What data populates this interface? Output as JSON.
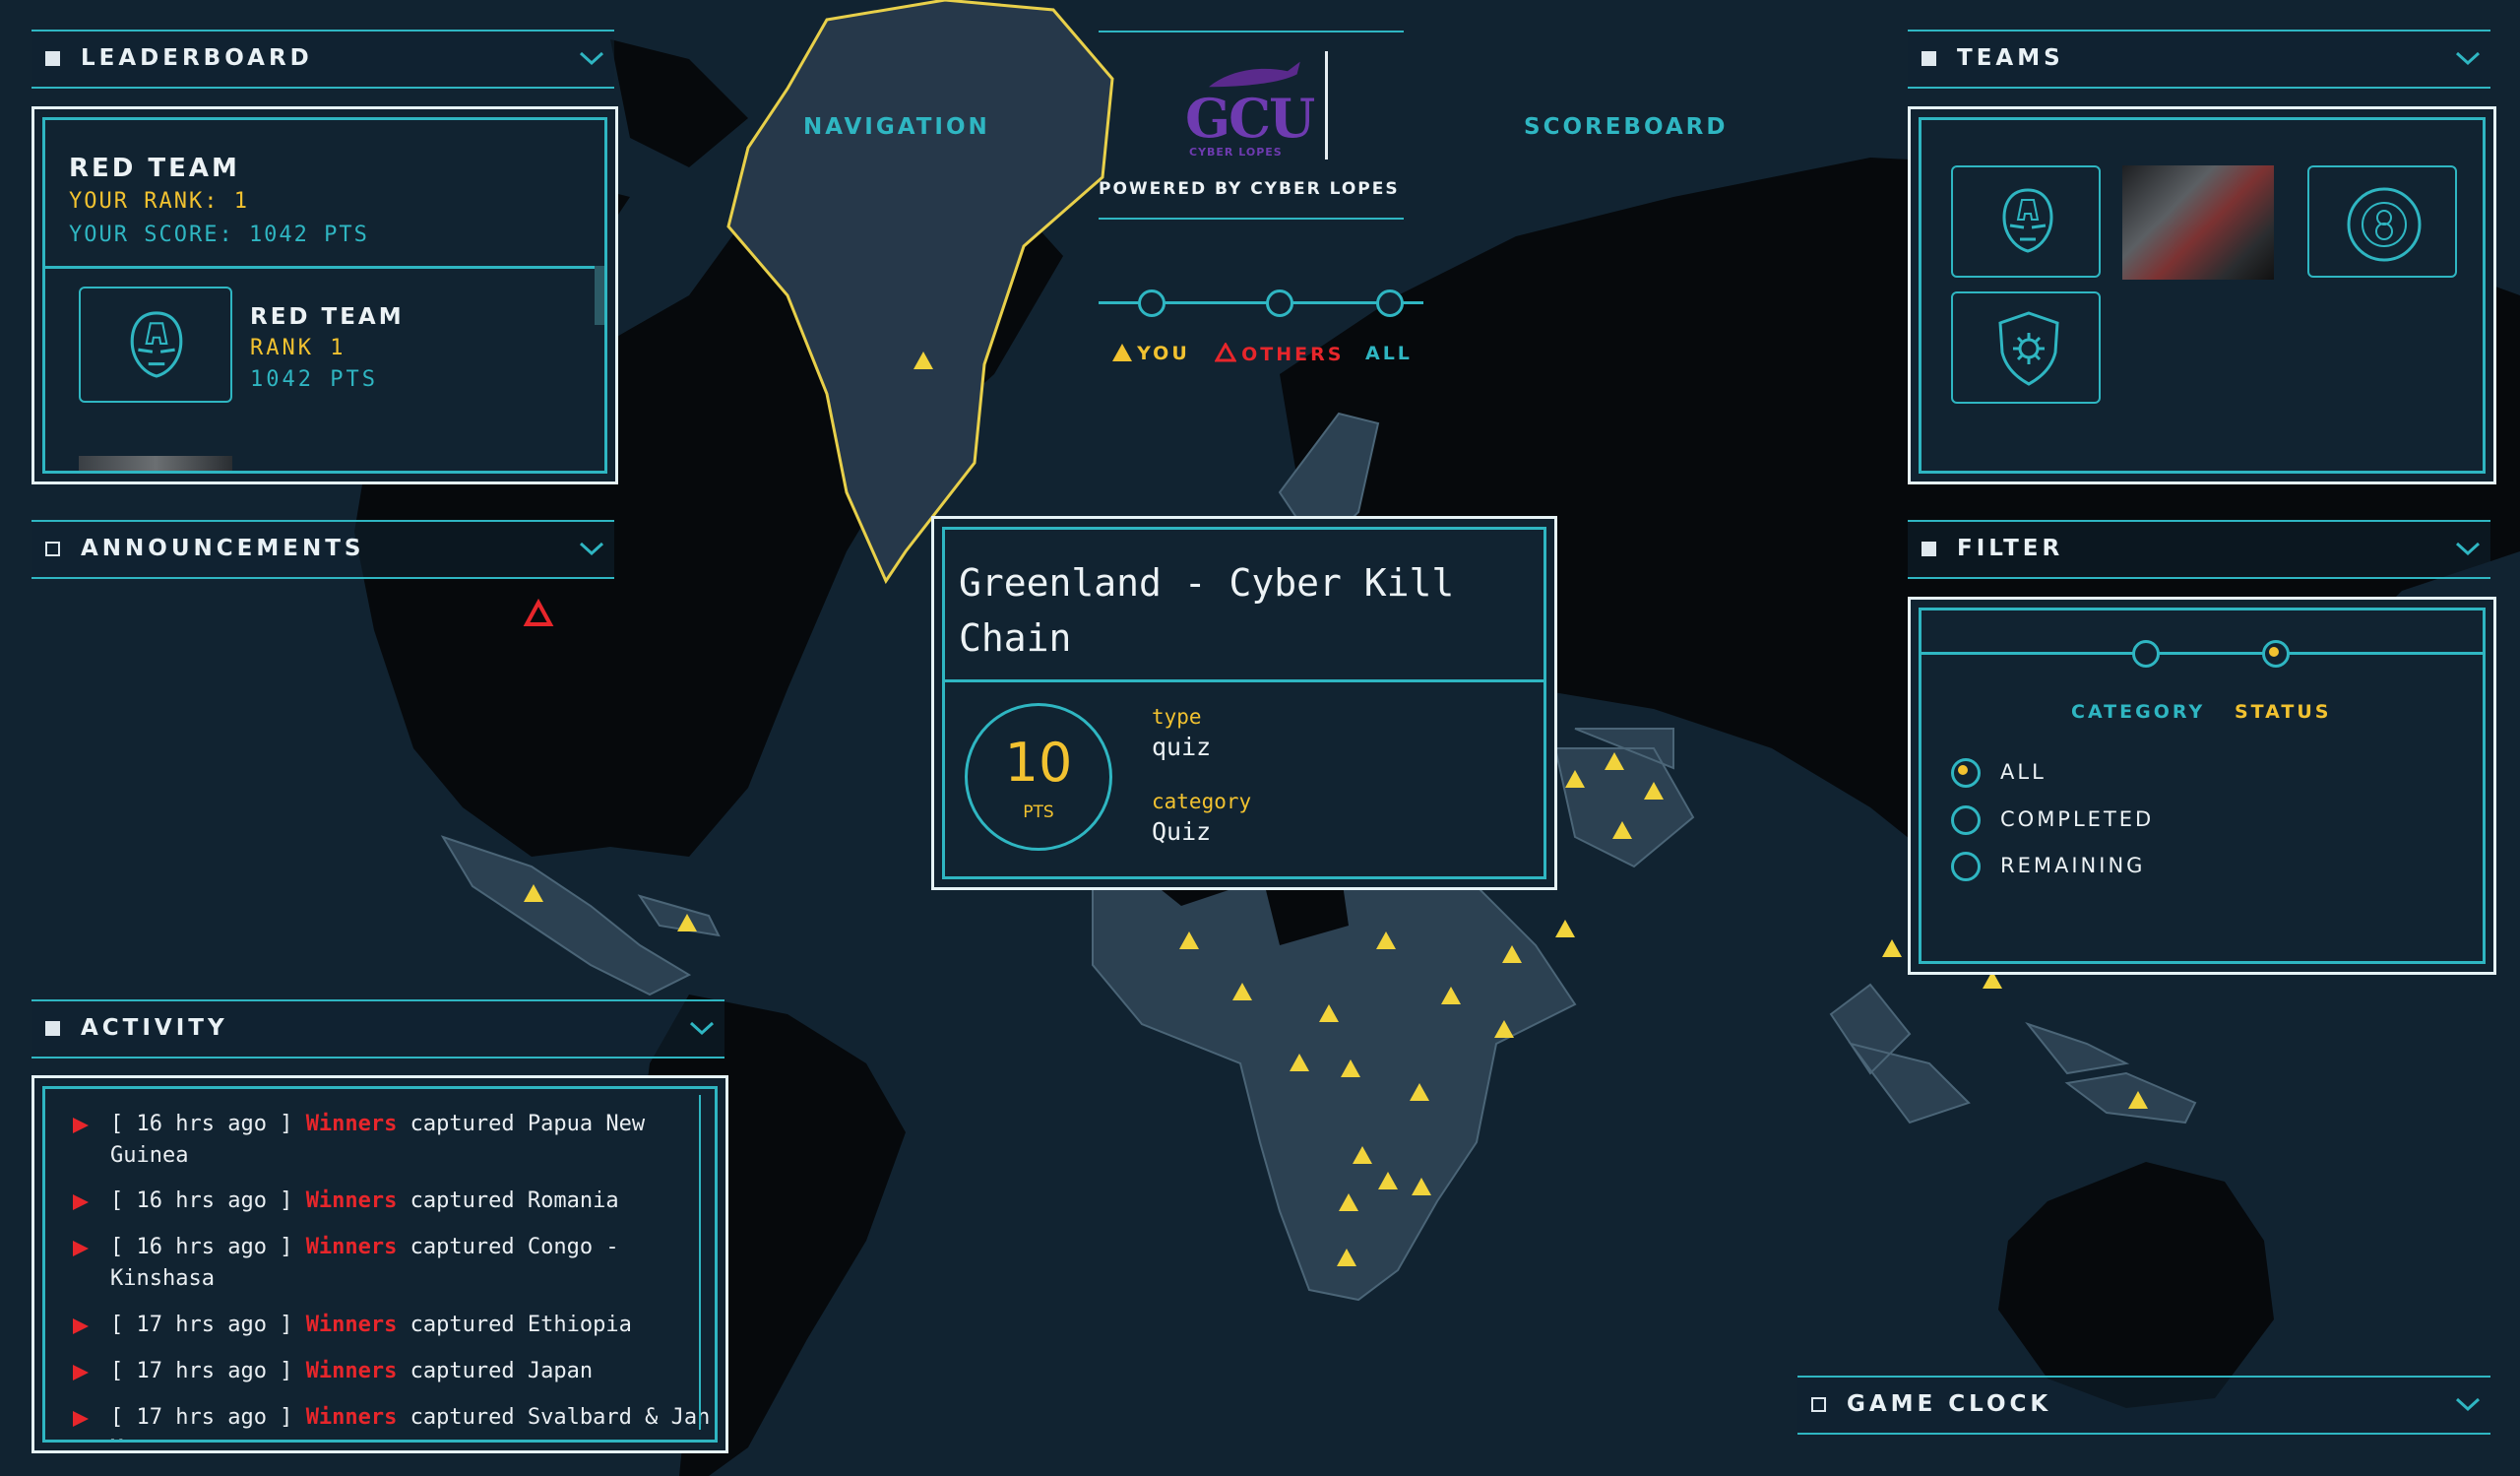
{
  "leaderboard": {
    "header": "LEADERBOARD",
    "team_name": "RED TEAM",
    "your_rank": "YOUR RANK: 1",
    "your_score": "YOUR SCORE: 1042  PTS",
    "entry": {
      "name": "RED TEAM",
      "rank": "RANK 1",
      "points": "1042 PTS"
    }
  },
  "announcements": {
    "header": "ANNOUNCEMENTS"
  },
  "activity": {
    "header": "ACTIVITY",
    "rows": [
      {
        "time": "[ 16 hrs ago ]",
        "team": "Winners",
        "verb": "captured",
        "target": "Papua New Guinea"
      },
      {
        "time": "[ 16 hrs ago ]",
        "team": "Winners",
        "verb": "captured",
        "target": "Romania"
      },
      {
        "time": "[ 16 hrs ago ]",
        "team": "Winners",
        "verb": "captured",
        "target": "Congo - Kinshasa"
      },
      {
        "time": "[ 17 hrs ago ]",
        "team": "Winners",
        "verb": "captured",
        "target": "Ethiopia"
      },
      {
        "time": "[ 17 hrs ago ]",
        "team": "Winners",
        "verb": "captured",
        "target": "Japan"
      },
      {
        "time": "[ 17 hrs ago ]",
        "team": "Winners",
        "verb": "captured",
        "target": "Svalbard & Jan Mayen"
      }
    ]
  },
  "nav": {
    "navigation": "NAVIGATION",
    "scoreboard": "SCOREBOARD",
    "logo_text": "GCU",
    "logo_sub": "CYBER LOPES",
    "powered": "POWERED BY CYBER LOPES",
    "legend_you": "YOU",
    "legend_others": "OTHERS",
    "legend_all": "ALL"
  },
  "popup": {
    "title": "Greenland - Cyber Kill Chain",
    "points": "10",
    "points_unit": "PTS",
    "type_label": "type",
    "type_value": "quiz",
    "category_label": "category",
    "category_value": "Quiz"
  },
  "teams": {
    "header": "TEAMS"
  },
  "filter": {
    "header": "FILTER",
    "tab_category": "CATEGORY",
    "tab_status": "STATUS",
    "options": [
      "ALL",
      "COMPLETED",
      "REMAINING"
    ]
  },
  "game_clock": {
    "header": "GAME CLOCK"
  },
  "colors": {
    "accent": "#2fb6c2",
    "highlight": "#f2c230",
    "alert": "#e7262b",
    "background": "#112331"
  }
}
